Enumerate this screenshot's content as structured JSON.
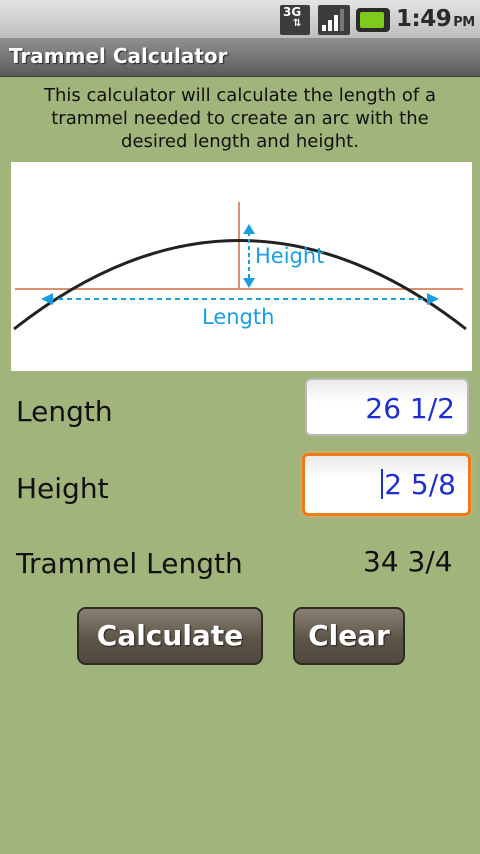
{
  "status_bar": {
    "network_label": "3G",
    "time": "1:49",
    "ampm": "PM"
  },
  "app": {
    "title": "Trammel Calculator"
  },
  "intro_text": "This calculator will calculate the length of a trammel needed to create an arc with the desired length and height.",
  "diagram": {
    "height_label": "Height",
    "length_label": "Length",
    "arc_color": "#222222",
    "guide_color": "#d89070",
    "dim_color": "#1a9ee0"
  },
  "form": {
    "length_label": "Length",
    "length_value": "26 1/2",
    "height_label": "Height",
    "height_value": "2 5/8",
    "result_label": "Trammel Length",
    "result_value": "34 3/4"
  },
  "buttons": {
    "calculate": "Calculate",
    "clear": "Clear"
  },
  "colors": {
    "background": "#a1b47c",
    "focus": "#f07b16",
    "input_text": "#1e2fd0"
  }
}
